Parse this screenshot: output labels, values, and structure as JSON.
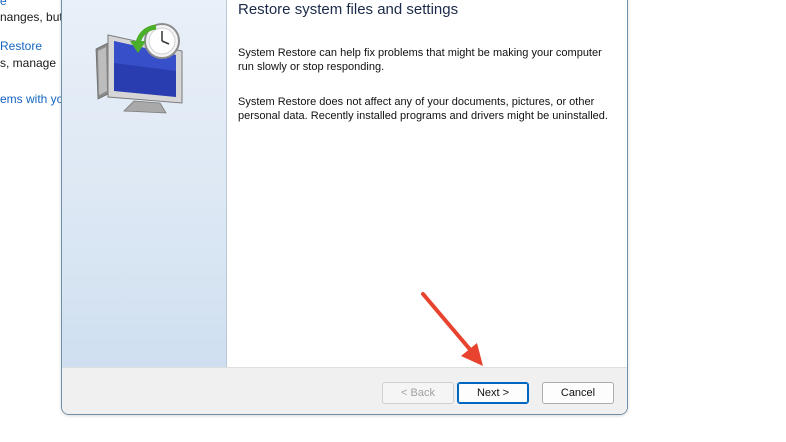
{
  "background": {
    "fragments": [
      {
        "text": "e",
        "link": true
      },
      {
        "text": "nanges, but",
        "link": false
      },
      {
        "text": "Restore",
        "link": true
      },
      {
        "text": "s, manage",
        "link": false
      },
      {
        "text": "ems with yo",
        "link": true
      }
    ]
  },
  "dialog": {
    "title": "Restore system files and settings",
    "paragraph1": "System Restore can help fix problems that might be making your computer run slowly or stop responding.",
    "paragraph2": "System Restore does not affect any of your documents, pictures, or other personal data. Recently installed programs and drivers might be uninstalled.",
    "illustration": "system-restore-icon",
    "buttons": {
      "back": "< Back",
      "next": "Next >",
      "cancel": "Cancel"
    }
  },
  "annotation": {
    "icon": "red-arrow-icon",
    "color": "#e8432f"
  },
  "colors": {
    "link": "#1565c0",
    "accent": "#0067c0"
  }
}
